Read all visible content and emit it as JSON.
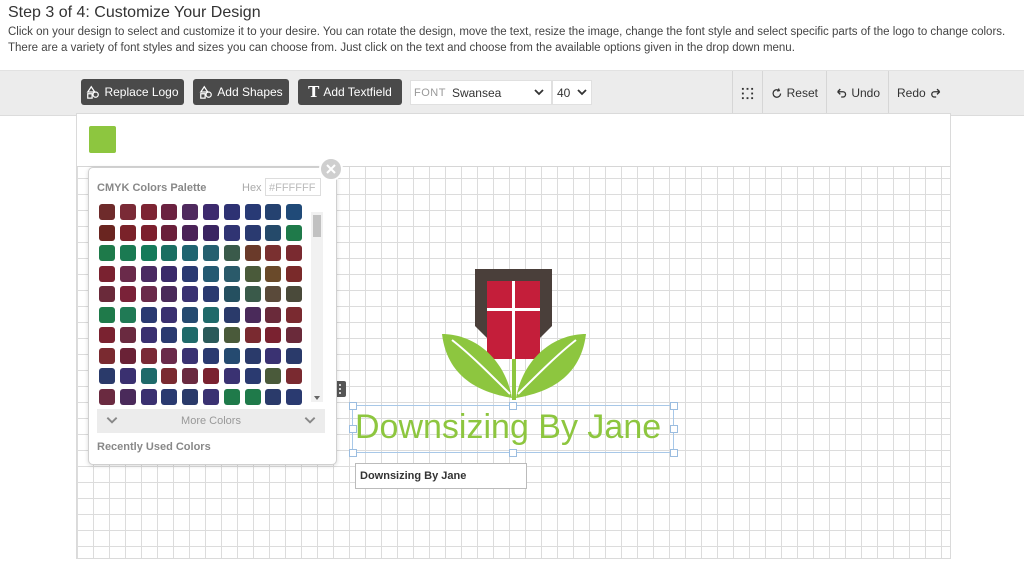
{
  "header": {
    "title": "Step 3 of 4: Customize Your Design",
    "description": "Click on your design to select and customize it to your desire. You can rotate the design, move the text, resize the image, change the font style and select specific parts of the logo to change colors. There are a variety of font styles and sizes you can choose from. Just click on the text and choose from the available options given in the drop down menu."
  },
  "toolbar": {
    "replace_logo": "Replace Logo",
    "add_shapes": "Add Shapes",
    "add_textfield": "Add Textfield",
    "font_label": "FONT",
    "font_value": "Swansea",
    "size_value": "40",
    "reset": "Reset",
    "undo": "Undo",
    "redo": "Redo"
  },
  "canvas": {
    "current_color": "#8dc63f",
    "logo_text": "Downsizing By Jane",
    "text_input_value": "Downsizing By Jane"
  },
  "palette": {
    "title": "CMYK Colors Palette",
    "hex_label": "Hex",
    "hex_placeholder": "#FFFFFF",
    "more_colors": "More Colors",
    "recent_label": "Recently Used Colors",
    "swatches": [
      "#6e2b2b",
      "#7a2a36",
      "#7d2433",
      "#6b2240",
      "#4f2a5e",
      "#3d2a6e",
      "#2e3273",
      "#283a75",
      "#254270",
      "#204a78",
      "#6a2520",
      "#7a2229",
      "#7c1f2d",
      "#6a1f3a",
      "#4a2257",
      "#3a2461",
      "#303473",
      "#2a3a70",
      "#254a6a",
      "#1f7a4a",
      "#1e7a4a",
      "#1a7a52",
      "#157a5a",
      "#1a6e62",
      "#1f6470",
      "#256070",
      "#3a5a4a",
      "#6a3a2a",
      "#7a3030",
      "#7a2a30",
      "#7a2230",
      "#6a2a4a",
      "#4a2a62",
      "#3a2a6a",
      "#2a3a72",
      "#245a72",
      "#2a5a6a",
      "#4a5a3a",
      "#6a4a2a",
      "#7a2a2a",
      "#6a2a3a",
      "#7a2238",
      "#6a2a4a",
      "#4a2a5a",
      "#3a3272",
      "#2a3a70",
      "#255060",
      "#3a5a4a",
      "#5a4a3a",
      "#4a4a3a",
      "#1f7a4a",
      "#207a55",
      "#2a3a72",
      "#3a3070",
      "#254a70",
      "#1f6a6a",
      "#2a3a6a",
      "#4a2a5a",
      "#6a2a3a",
      "#7a2a30",
      "#7a2230",
      "#6a2a40",
      "#3a3070",
      "#2a3a70",
      "#1f6a6a",
      "#2a5a5a",
      "#4a5a3a",
      "#7a2a30",
      "#7a2230",
      "#6a2a3a",
      "#7a2a30",
      "#6a2236",
      "#7a2a36",
      "#6a2a4a",
      "#3a3272",
      "#2a3a70",
      "#254a70",
      "#2a3a6a",
      "#3a3272",
      "#2a3a6a",
      "#2a3a6a",
      "#3a3070",
      "#1f6a6a",
      "#7a2a30",
      "#6a2a40",
      "#7a2230",
      "#3a3272",
      "#2a3a70",
      "#4a5a3a",
      "#7a2a30",
      "#6a2a40",
      "#4a2a5a",
      "#3a3070",
      "#2a3a70",
      "#2a3a6a",
      "#3a3272",
      "#1f7a4a",
      "#1f7a4a",
      "#2a3a6a",
      "#2a3a70"
    ]
  },
  "colors": {
    "logo_green": "#8dc63f",
    "logo_red": "#c41e3a",
    "logo_brown": "#4a3f3a"
  }
}
